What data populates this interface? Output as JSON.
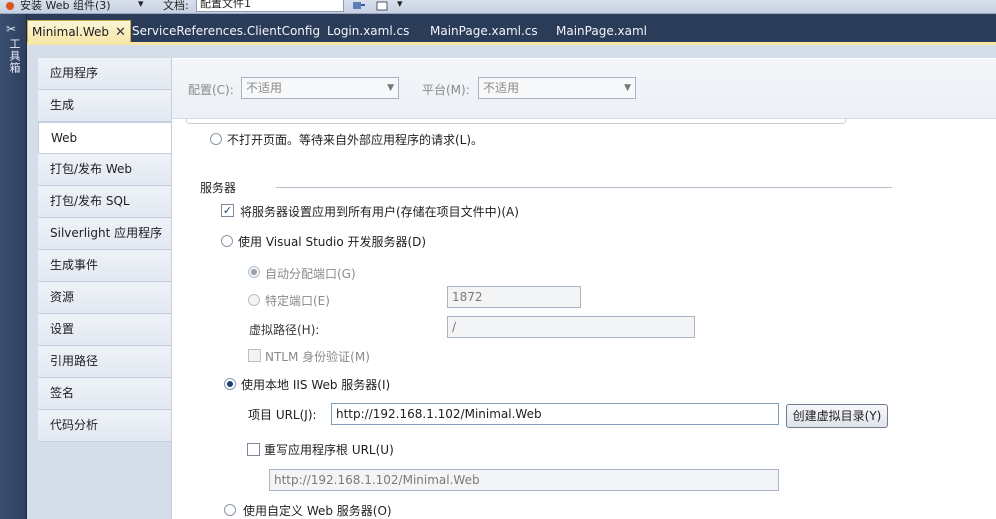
{
  "topbar": {
    "left_text": "安装 Web 组件(3)",
    "doc_label": "文档:",
    "doc_value": "配置文件1"
  },
  "toolbox": {
    "label": "工具箱"
  },
  "tabs": [
    {
      "label": "Minimal.Web",
      "active": true,
      "close": "✕"
    },
    {
      "label": "ServiceReferences.ClientConfig"
    },
    {
      "label": "Login.xaml.cs"
    },
    {
      "label": "MainPage.xaml.cs"
    },
    {
      "label": "MainPage.xaml"
    }
  ],
  "nav": {
    "items": [
      {
        "label": "应用程序"
      },
      {
        "label": "生成"
      },
      {
        "label": "Web",
        "active": true
      },
      {
        "label": "打包/发布 Web"
      },
      {
        "label": "打包/发布 SQL"
      },
      {
        "label": "Silverlight 应用程序"
      },
      {
        "label": "生成事件"
      },
      {
        "label": "资源"
      },
      {
        "label": "设置"
      },
      {
        "label": "引用路径"
      },
      {
        "label": "签名"
      },
      {
        "label": "代码分析"
      }
    ]
  },
  "config": {
    "config_label": "配置(C):",
    "config_value": "不适用",
    "platform_label": "平台(M):",
    "platform_value": "不适用"
  },
  "start": {
    "no_open_label": "不打开页面。等待来自外部应用程序的请求(L)。"
  },
  "servers": {
    "section_title": "服务器",
    "apply_all_label": "将服务器设置应用到所有用户(存储在项目文件中)(A)",
    "apply_all_checked": "✓",
    "vs_server_label": "使用 Visual  Studio 开发服务器(D)",
    "auto_port_label": "自动分配端口(G)",
    "specific_port_label": "特定端口(E)",
    "specific_port_value": "1872",
    "virtual_path_label": "虚拟路径(H):",
    "virtual_path_value": "/",
    "ntlm_label": "NTLM 身份验证(M)",
    "iis_label": "使用本地 IIS Web 服务器(I)",
    "project_url_label": "项目 URL(J):",
    "project_url_value": "http://192.168.1.102/Minimal.Web",
    "create_vdir_button": "创建虚拟目录(Y)",
    "override_root_label": "重写应用程序根 URL(U)",
    "override_root_value": "http://192.168.1.102/Minimal.Web",
    "custom_server_label": "使用自定义 Web 服务器(O)"
  }
}
